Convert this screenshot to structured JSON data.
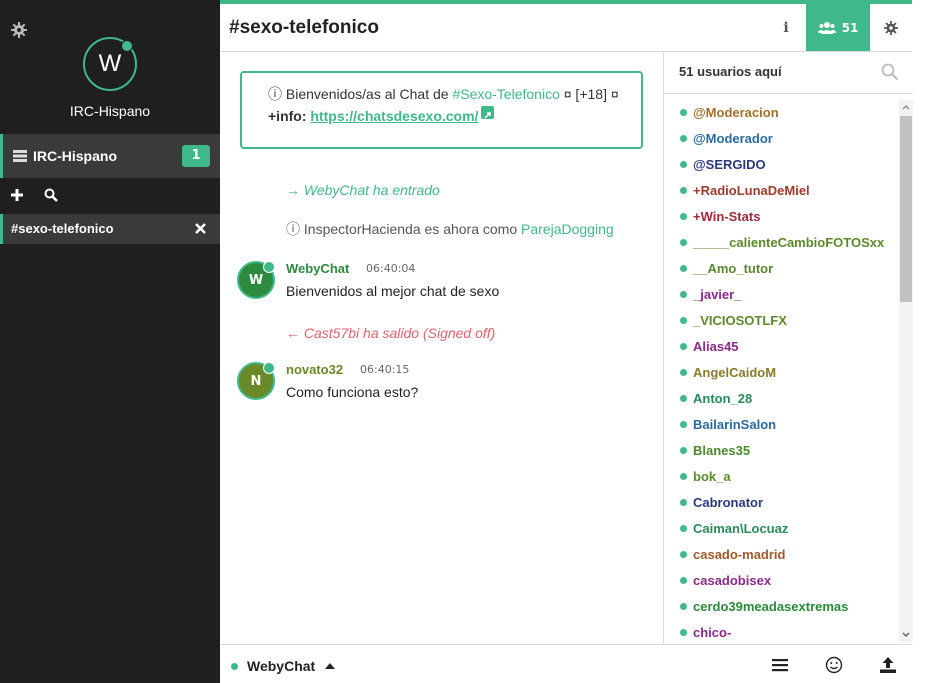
{
  "sidebar": {
    "avatar_letter": "W",
    "network_name": "IRC-Hispano",
    "network_row_label": "IRC-Hispano",
    "unread_count": "1",
    "channel_label": "#sexo-telefonico"
  },
  "header": {
    "channel_title": "#sexo-telefonico",
    "info_label": "i",
    "users_count": "51"
  },
  "topic": {
    "prefix": "ⓘ Bienvenidos/as al Chat de ",
    "highlight": "#Sexo-Telefonico",
    "middle": " ¤ [+18] ¤ ",
    "info_label": "+info:",
    "link_text": "https://chatsdesexo.com/"
  },
  "events": {
    "join": "→ WebyChat ha entrado",
    "nick_prefix": "ⓘ InspectorHacienda es ahora como ",
    "nick_new": "ParejaDogging",
    "quit": "← Cast57bi ha salido (Signed off)"
  },
  "messages": [
    {
      "avatar": "W",
      "nick": "WebyChat",
      "time": "06:40:04",
      "text": "Bienvenidos al mejor chat de sexo"
    },
    {
      "avatar": "N",
      "nick": "novato32",
      "time": "06:40:15",
      "text": "Como funciona esto?"
    }
  ],
  "userlist": {
    "count_label": "51 usuarios aquí",
    "users": [
      {
        "name": "@Moderacion",
        "color": "#a0702a"
      },
      {
        "name": "@Moderador",
        "color": "#2a6aa0"
      },
      {
        "name": "@SERGIDO",
        "color": "#2a3a80"
      },
      {
        "name": "+RadioLunaDeMiel",
        "color": "#a03a2a"
      },
      {
        "name": "+Win-Stats",
        "color": "#a02a3a"
      },
      {
        "name": "_____calienteCambioFOTOSxx",
        "color": "#5a8a2a"
      },
      {
        "name": "__Amo_tutor",
        "color": "#5a8a2a"
      },
      {
        "name": "_javier_",
        "color": "#8a2a8a"
      },
      {
        "name": "_VICIOSOTLFX",
        "color": "#5a8a2a"
      },
      {
        "name": "Alias45",
        "color": "#8a2a8a"
      },
      {
        "name": "AngelCaidoM",
        "color": "#8a7a2a"
      },
      {
        "name": "Anton_28",
        "color": "#2a8a5a"
      },
      {
        "name": "BailarinSalon",
        "color": "#2a6aa0"
      },
      {
        "name": "Blanes35",
        "color": "#4a8a2a"
      },
      {
        "name": "bok_a",
        "color": "#5a8a2a"
      },
      {
        "name": "Cabronator",
        "color": "#2a3a80"
      },
      {
        "name": "Caiman\\Locuaz",
        "color": "#2a8a5a"
      },
      {
        "name": "casado-madrid",
        "color": "#a05a2a"
      },
      {
        "name": "casadobisex",
        "color": "#8a2a8a"
      },
      {
        "name": "cerdo39meadasextremas",
        "color": "#2a8a3a"
      },
      {
        "name": "chico-",
        "color": "#8a2a8a"
      }
    ]
  },
  "footer": {
    "nick": "WebyChat"
  },
  "colors": {
    "accent": "#3fb88a",
    "sidebar_bg": "#1f1f1f",
    "quit": "#e0626a"
  }
}
